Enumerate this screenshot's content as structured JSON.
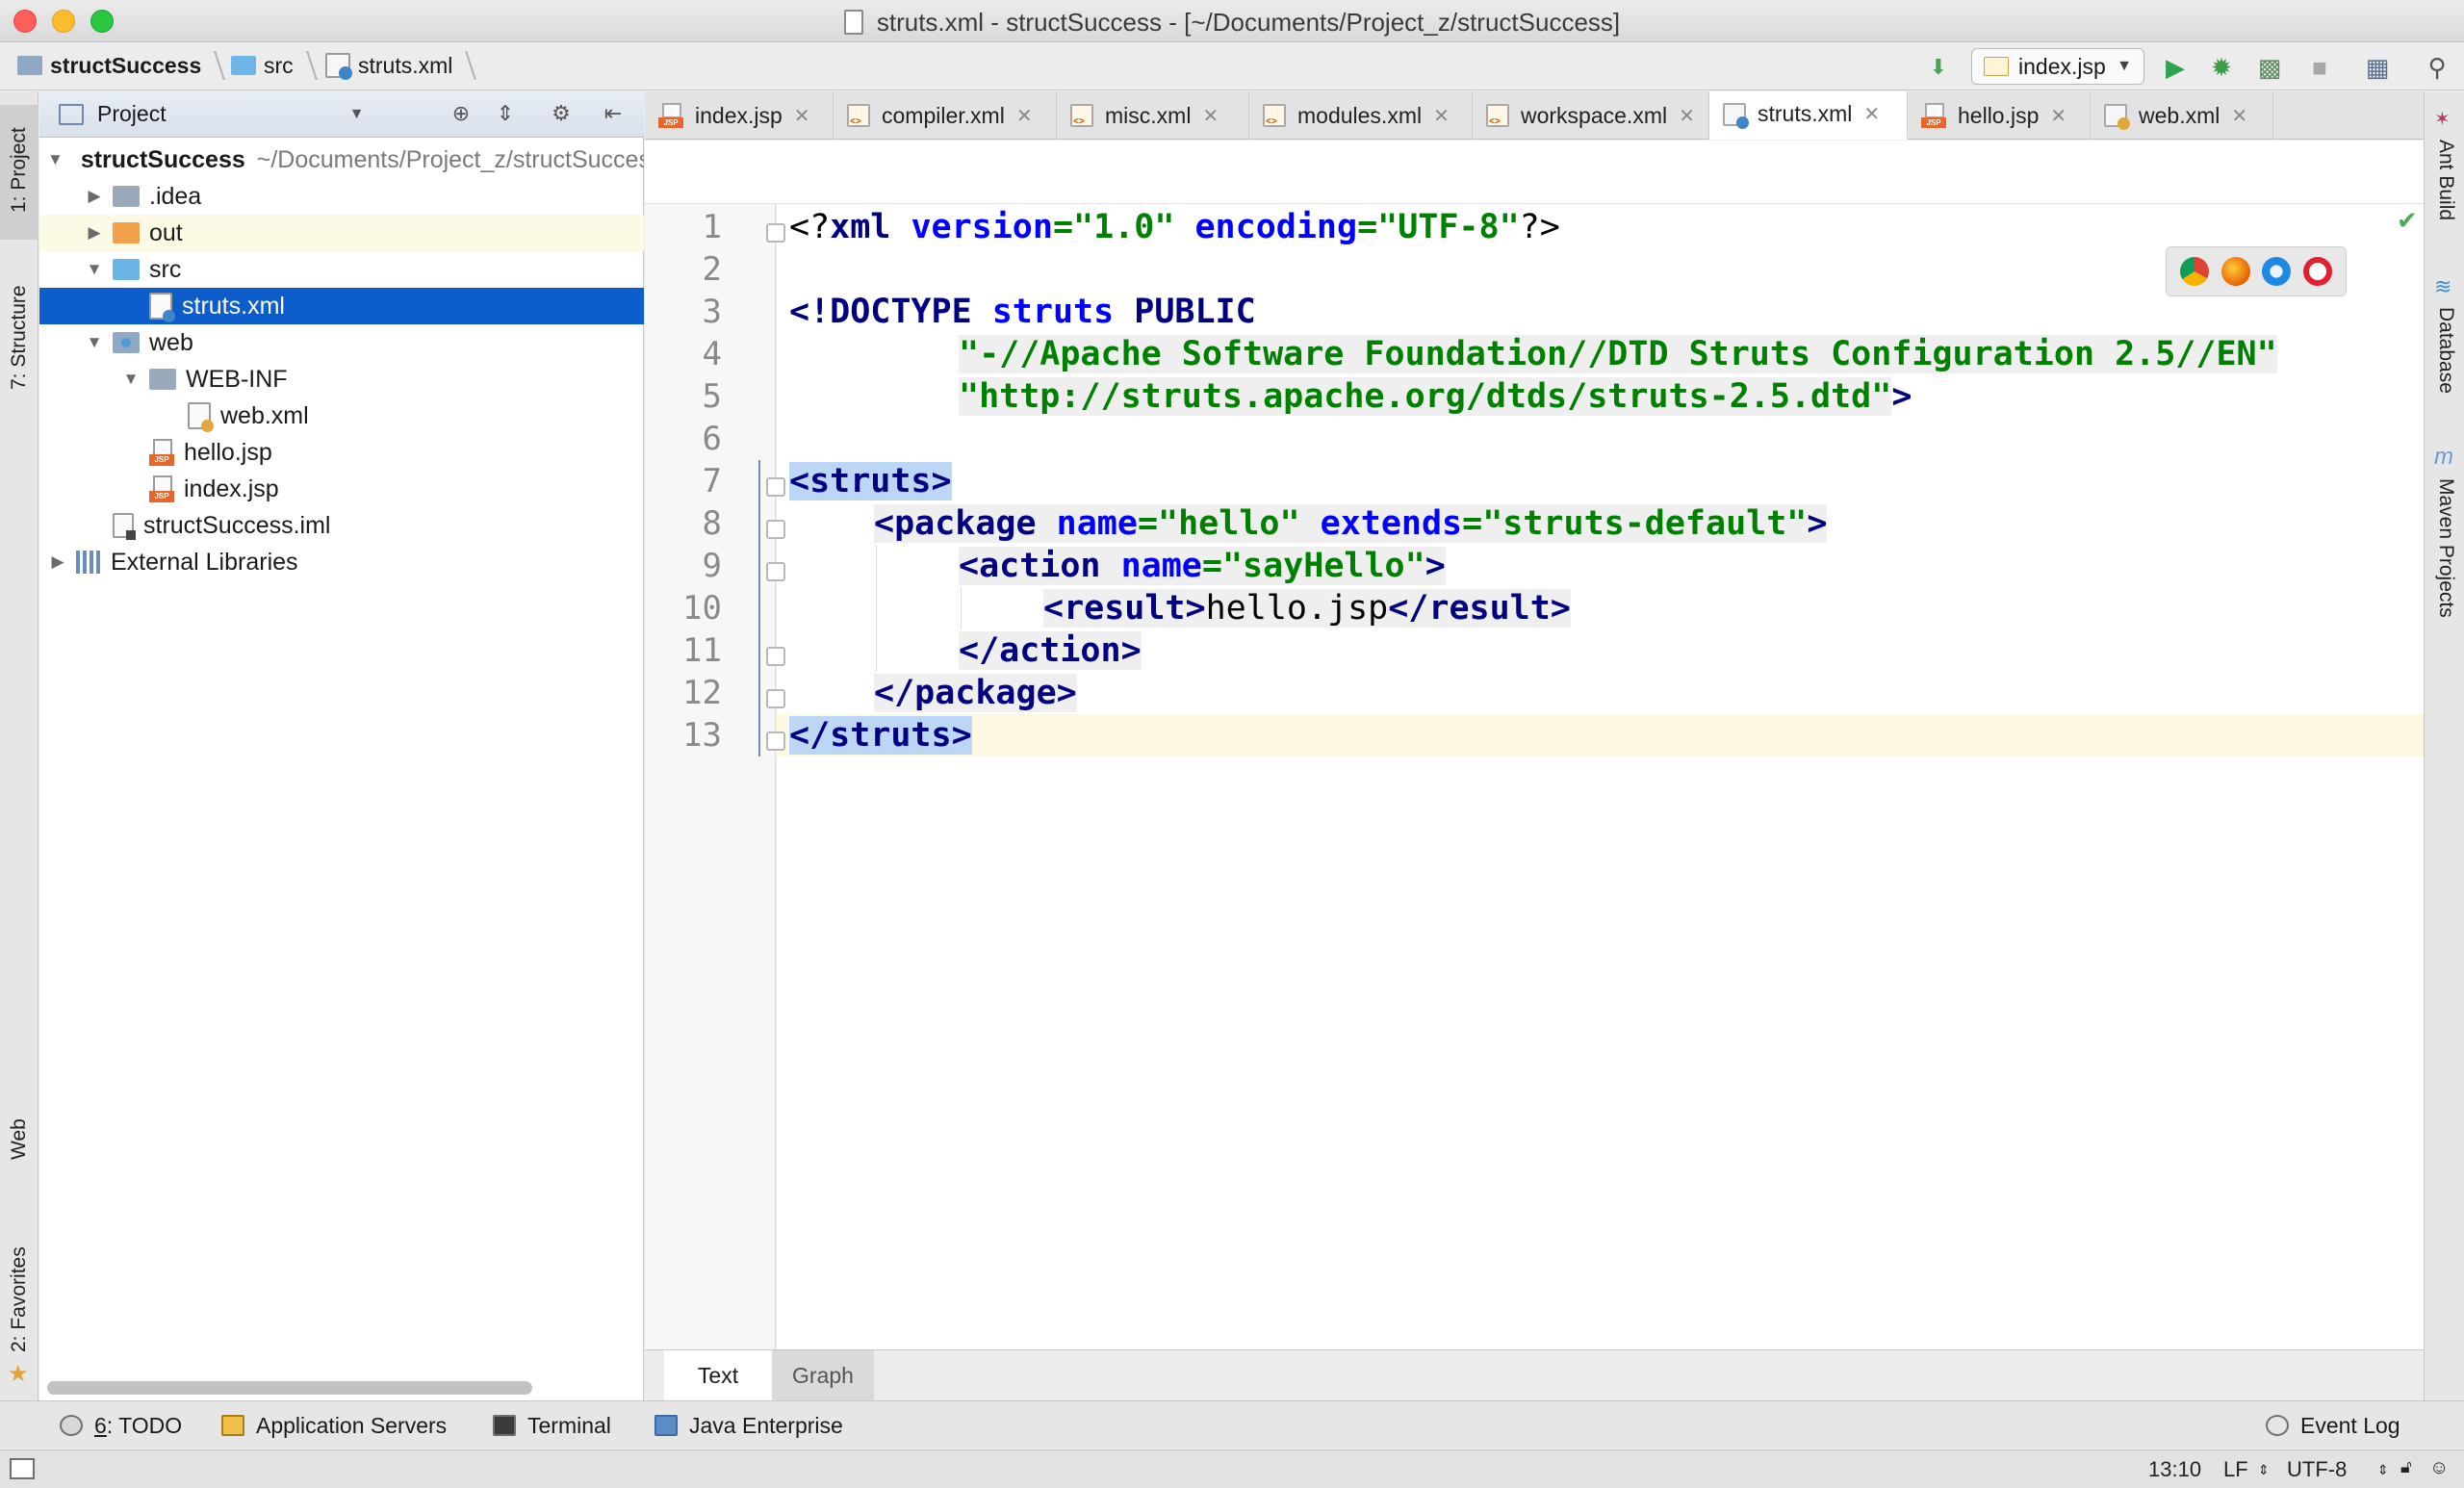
{
  "window": {
    "title": "struts.xml - structSuccess - [~/Documents/Project_z/structSuccess]"
  },
  "navbar": {
    "breadcrumbs": [
      "structSuccess",
      "src",
      "struts.xml"
    ],
    "run_config": "index.jsp"
  },
  "left_strip": {
    "tabs": [
      "1: Project",
      "7: Structure",
      "Web",
      "2: Favorites"
    ]
  },
  "right_strip": {
    "tabs": [
      "Ant Build",
      "Database",
      "Maven Projects"
    ]
  },
  "project_panel": {
    "title": "Project",
    "tree": [
      {
        "label": "structSuccess",
        "path": "~/Documents/Project_z/structSuccess",
        "depth": 0,
        "expanded": true,
        "kind": "module"
      },
      {
        "label": ".idea",
        "depth": 1,
        "expanded": false,
        "kind": "folder"
      },
      {
        "label": "out",
        "depth": 1,
        "expanded": false,
        "kind": "folder-out"
      },
      {
        "label": "src",
        "depth": 1,
        "expanded": true,
        "kind": "folder-src"
      },
      {
        "label": "struts.xml",
        "depth": 2,
        "kind": "xml-config",
        "selected": true
      },
      {
        "label": "web",
        "depth": 1,
        "expanded": true,
        "kind": "folder-web"
      },
      {
        "label": "WEB-INF",
        "depth": 2,
        "expanded": true,
        "kind": "folder"
      },
      {
        "label": "web.xml",
        "depth": 3,
        "kind": "web-xml"
      },
      {
        "label": "hello.jsp",
        "depth": 2,
        "kind": "jsp"
      },
      {
        "label": "index.jsp",
        "depth": 2,
        "kind": "jsp"
      },
      {
        "label": "structSuccess.iml",
        "depth": 1,
        "kind": "iml"
      },
      {
        "label": "External Libraries",
        "depth": 0,
        "expanded": false,
        "kind": "libs"
      }
    ]
  },
  "editor_tabs": [
    {
      "label": "index.jsp",
      "icon": "jsp"
    },
    {
      "label": "compiler.xml",
      "icon": "xml"
    },
    {
      "label": "misc.xml",
      "icon": "xml"
    },
    {
      "label": "modules.xml",
      "icon": "xml"
    },
    {
      "label": "workspace.xml",
      "icon": "xml"
    },
    {
      "label": "struts.xml",
      "icon": "cfg",
      "active": true
    },
    {
      "label": "hello.jsp",
      "icon": "jsp"
    },
    {
      "label": "web.xml",
      "icon": "web"
    }
  ],
  "editor": {
    "line_numbers": [
      "1",
      "2",
      "3",
      "4",
      "5",
      "6",
      "7",
      "8",
      "9",
      "10",
      "11",
      "12",
      "13"
    ],
    "code": {
      "l1_open": "<?",
      "l1_xml": "xml",
      "l1_version_attr": "version",
      "l1_eq1": "=",
      "l1_version_val": "\"1.0\"",
      "l1_encoding_attr": "encoding",
      "l1_eq2": "=",
      "l1_encoding_val": "\"UTF-8\"",
      "l1_close": "?>",
      "l3_doctype": "<!DOCTYPE",
      "l3_struts": "struts",
      "l3_public": "PUBLIC",
      "l4_fpi": "\"-//Apache Software Foundation//DTD Struts Configuration 2.5//EN\"",
      "l5_url": "\"http://struts.apache.org/dtds/struts-2.5.dtd\"",
      "l5_close": ">",
      "l7_tag": "<struts>",
      "l8_open": "<package",
      "l8_name_attr": "name",
      "l8_name_val": "\"hello\"",
      "l8_ext_attr": "extends",
      "l8_ext_val": "\"struts-default\"",
      "l8_close": ">",
      "l9_open": "<action",
      "l9_name_attr": "name",
      "l9_name_val": "\"sayHello\"",
      "l9_close": ">",
      "l10_open": "<result>",
      "l10_text": "hello.jsp",
      "l10_close": "</result>",
      "l11_tag": "</action>",
      "l12_tag": "</package>",
      "l13_tag": "</struts>"
    }
  },
  "bottom_tabs": [
    "Text",
    "Graph"
  ],
  "tool_windows": {
    "todo_key": "6",
    "todo_rest": ": TODO",
    "app_servers": "Application Servers",
    "terminal": "Terminal",
    "java_enterprise": "Java Enterprise",
    "event_log": "Event Log"
  },
  "statusbar": {
    "position": "13:10",
    "line_sep": "LF",
    "encoding": "UTF-8"
  },
  "colors": {
    "selection": "#0d5ccb",
    "tag": "#000080",
    "attribute": "#0000ff",
    "value": "#008000",
    "current_line": "#fcf8e1"
  }
}
